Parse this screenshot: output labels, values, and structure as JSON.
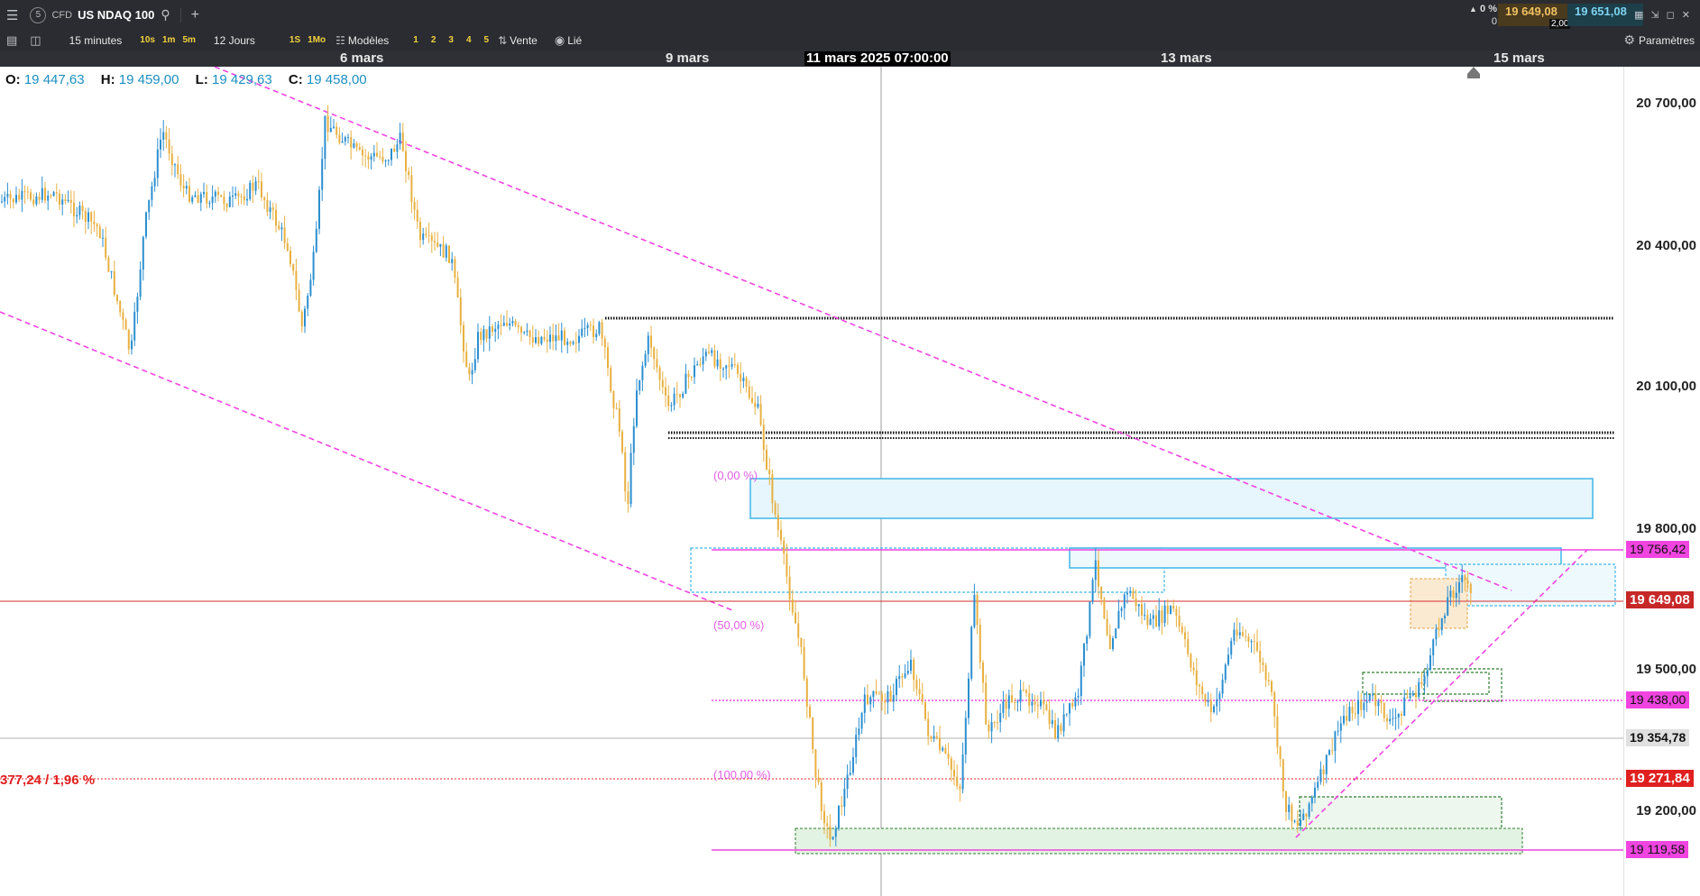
{
  "topbar": {
    "menu_icon": "menu-icon",
    "instrument_number": "5",
    "instrument_type": "CFD",
    "instrument_name": "US NDAQ 100",
    "search_icon": "search-icon",
    "add_icon": "plus-icon",
    "change_pct": "0 %",
    "change_value": "0",
    "sell_price": "19 649,08",
    "spread": "2,00",
    "buy_price": "19 651,08"
  },
  "toolbar": {
    "interval": "15 minutes",
    "quick_intervals": [
      "10s",
      "1m",
      "5m"
    ],
    "range": "12 Jours",
    "quick_ranges": [
      "1S",
      "1Mo"
    ],
    "templates_label": "Modèles",
    "layouts": [
      "1",
      "2",
      "3",
      "4",
      "5"
    ],
    "sell_label": "Vente",
    "link_label": "Lié",
    "settings_label": "Paramètres"
  },
  "date_axis": {
    "labels": [
      "6 mars",
      "9 mars",
      "13 mars",
      "15 mars"
    ],
    "cursor_label": "11 mars 2025 07:00:00"
  },
  "ohlc": {
    "o_label": "O:",
    "o": "19 447,63",
    "h_label": "H:",
    "h": "19 459,00",
    "l_label": "L:",
    "l": "19 429,63",
    "c_label": "C:",
    "c": "19 458,00"
  },
  "price_axis": {
    "ticks": [
      "20 700,00",
      "20 400,00",
      "20 100,00",
      "19 800,00",
      "19 500,00",
      "19 200,00"
    ],
    "level_fib0": "19 756,42",
    "level_current": "19 649,08",
    "level_fib50": "19 438,00",
    "level_crosshair": "19 354,78",
    "level_stop": "19 271,84",
    "level_fib100": "19 119,58"
  },
  "fib_labels": {
    "fib0": "(0,00 %)",
    "fib50": "(50,00 %)",
    "fib100": "(100,00 %)"
  },
  "pnl_label": "377,24 / 1,96 %",
  "colors": {
    "bull_candle": "#2b8fd0",
    "bear_candle": "#e8b040",
    "trendline": "#f044e0",
    "current_line": "#d32f2f",
    "zone_blue": "#3fb6e6",
    "zone_green": "#3c9a3c"
  }
}
